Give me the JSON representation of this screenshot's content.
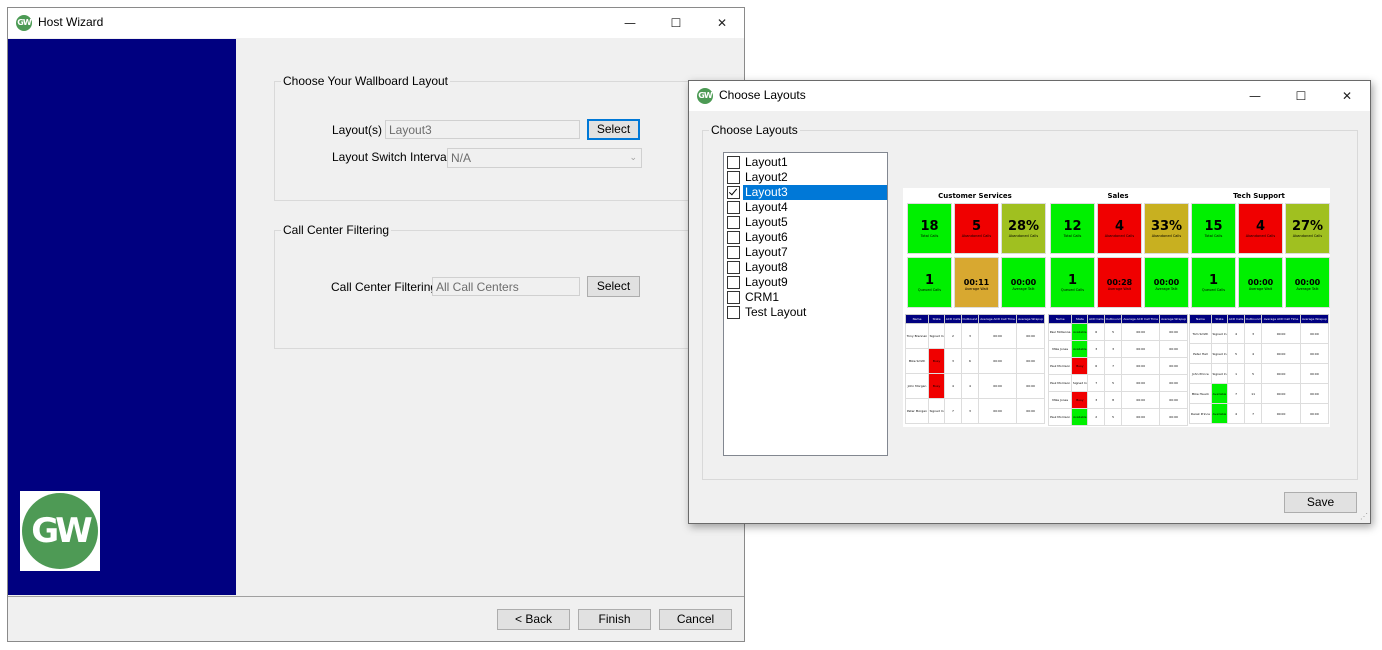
{
  "host_wizard": {
    "title": "Host Wizard",
    "icon_text": "GW",
    "logo_text": "GW",
    "layout_group": {
      "title": "Choose Your Wallboard Layout",
      "layouts_label": "Layout(s)",
      "layouts_value": "Layout3",
      "select_label": "Select",
      "interval_label": "Layout Switch Interval",
      "interval_value": "N/A"
    },
    "filter_group": {
      "title": "Call Center Filtering",
      "filter_label": "Call Center Filtering",
      "filter_value": "All Call Centers",
      "select_label": "Select"
    },
    "footer": {
      "back": "< Back",
      "finish": "Finish",
      "cancel": "Cancel"
    }
  },
  "choose_layouts": {
    "title": "Choose Layouts",
    "icon_text": "GW",
    "group_title": "Choose Layouts",
    "items": [
      {
        "label": "Layout1",
        "checked": false,
        "selected": false
      },
      {
        "label": "Layout2",
        "checked": false,
        "selected": false
      },
      {
        "label": "Layout3",
        "checked": true,
        "selected": true
      },
      {
        "label": "Layout4",
        "checked": false,
        "selected": false
      },
      {
        "label": "Layout5",
        "checked": false,
        "selected": false
      },
      {
        "label": "Layout6",
        "checked": false,
        "selected": false
      },
      {
        "label": "Layout7",
        "checked": false,
        "selected": false
      },
      {
        "label": "Layout8",
        "checked": false,
        "selected": false
      },
      {
        "label": "Layout9",
        "checked": false,
        "selected": false
      },
      {
        "label": "CRM1",
        "checked": false,
        "selected": false
      },
      {
        "label": "Test Layout",
        "checked": false,
        "selected": false
      }
    ],
    "save_label": "Save",
    "preview": {
      "sections": [
        {
          "title": "Customer Services",
          "tiles": [
            {
              "value": "18",
              "label": "Total Calls",
              "color": "#00f000"
            },
            {
              "value": "5",
              "label": "Abandoned Calls",
              "color": "#f00000"
            },
            {
              "value": "28%",
              "label": "Abandoned Calls",
              "color": "#a0c020"
            },
            {
              "value": "1",
              "label": "Queued Calls",
              "color": "#00f000"
            },
            {
              "value": "00:11",
              "label": "Average Wait",
              "color": "#d8a830"
            },
            {
              "value": "00:00",
              "label": "Average Talk",
              "color": "#00f000"
            }
          ],
          "rows": [
            {
              "name": "Tony Brennan",
              "state": "Signed In",
              "state_color": "#ffffff",
              "acd": "2",
              "outbound": "3",
              "avg_acd": "00:00",
              "avg_wrap": "00:00"
            },
            {
              "name": "Mike Smith",
              "state": "Busy",
              "state_color": "#f00000",
              "acd": "3",
              "outbound": "6",
              "avg_acd": "00:00",
              "avg_wrap": "00:00"
            },
            {
              "name": "John Morgan",
              "state": "Busy",
              "state_color": "#f00000",
              "acd": "4",
              "outbound": "4",
              "avg_acd": "00:00",
              "avg_wrap": "00:00"
            },
            {
              "name": "Peter Morgan",
              "state": "Signed In",
              "state_color": "#ffffff",
              "acd": "7",
              "outbound": "3",
              "avg_acd": "00:00",
              "avg_wrap": "00:00"
            }
          ]
        },
        {
          "title": "Sales",
          "tiles": [
            {
              "value": "12",
              "label": "Total Calls",
              "color": "#00f000"
            },
            {
              "value": "4",
              "label": "Abandoned Calls",
              "color": "#f00000"
            },
            {
              "value": "33%",
              "label": "Abandoned Calls",
              "color": "#c8b020"
            },
            {
              "value": "1",
              "label": "Queued Calls",
              "color": "#00f000"
            },
            {
              "value": "00:28",
              "label": "Average Wait",
              "color": "#f00000"
            },
            {
              "value": "00:00",
              "label": "Average Talk",
              "color": "#00f000"
            }
          ],
          "rows": [
            {
              "name": "Paul McKenna",
              "state": "Available",
              "state_color": "#00f000",
              "acd": "6",
              "outbound": "5",
              "avg_acd": "00:00",
              "avg_wrap": "00:00"
            },
            {
              "name": "Mike Jones",
              "state": "Available",
              "state_color": "#00f000",
              "acd": "3",
              "outbound": "3",
              "avg_acd": "00:00",
              "avg_wrap": "00:00"
            },
            {
              "name": "Paul Morrison",
              "state": "Busy",
              "state_color": "#f00000",
              "acd": "6",
              "outbound": "7",
              "avg_acd": "00:00",
              "avg_wrap": "00:00"
            },
            {
              "name": "Paul Morrison",
              "state": "Signed In",
              "state_color": "#ffffff",
              "acd": "7",
              "outbound": "5",
              "avg_acd": "00:00",
              "avg_wrap": "00:00"
            },
            {
              "name": "Mike Jones",
              "state": "Busy",
              "state_color": "#f00000",
              "acd": "3",
              "outbound": "8",
              "avg_acd": "00:00",
              "avg_wrap": "00:00"
            },
            {
              "name": "Paul Morrison",
              "state": "Available",
              "state_color": "#00f000",
              "acd": "2",
              "outbound": "5",
              "avg_acd": "00:00",
              "avg_wrap": "00:00"
            }
          ]
        },
        {
          "title": "Tech Support",
          "tiles": [
            {
              "value": "15",
              "label": "Total Calls",
              "color": "#00f000"
            },
            {
              "value": "4",
              "label": "Abandoned Calls",
              "color": "#f00000"
            },
            {
              "value": "27%",
              "label": "Abandoned Calls",
              "color": "#a0c020"
            },
            {
              "value": "1",
              "label": "Queued Calls",
              "color": "#00f000"
            },
            {
              "value": "00:00",
              "label": "Average Wait",
              "color": "#00f000"
            },
            {
              "value": "00:00",
              "label": "Average Talk",
              "color": "#00f000"
            }
          ],
          "rows": [
            {
              "name": "Tom Smith",
              "state": "Signed In",
              "state_color": "#ffffff",
              "acd": "4",
              "outbound": "3",
              "avg_acd": "00:00",
              "avg_wrap": "00:00"
            },
            {
              "name": "Peter Hall",
              "state": "Signed In",
              "state_color": "#ffffff",
              "acd": "5",
              "outbound": "4",
              "avg_acd": "00:00",
              "avg_wrap": "00:00"
            },
            {
              "name": "John Prince",
              "state": "Signed In",
              "state_color": "#ffffff",
              "acd": "1",
              "outbound": "5",
              "avg_acd": "00:00",
              "avg_wrap": "00:00"
            },
            {
              "name": "Mike Hauck",
              "state": "Available",
              "state_color": "#00f000",
              "acd": "7",
              "outbound": "11",
              "avg_acd": "00:00",
              "avg_wrap": "00:00"
            },
            {
              "name": "Derek Prince",
              "state": "Available",
              "state_color": "#00f000",
              "acd": "4",
              "outbound": "7",
              "avg_acd": "00:00",
              "avg_wrap": "00:00"
            }
          ]
        }
      ],
      "table_headers": [
        "Name",
        "State",
        "ACD Calls",
        "Outbound",
        "Average ACD Call Time",
        "Average Wrapup"
      ]
    }
  },
  "window_controls": {
    "minimize": "—",
    "maximize": "☐",
    "close": "✕"
  }
}
